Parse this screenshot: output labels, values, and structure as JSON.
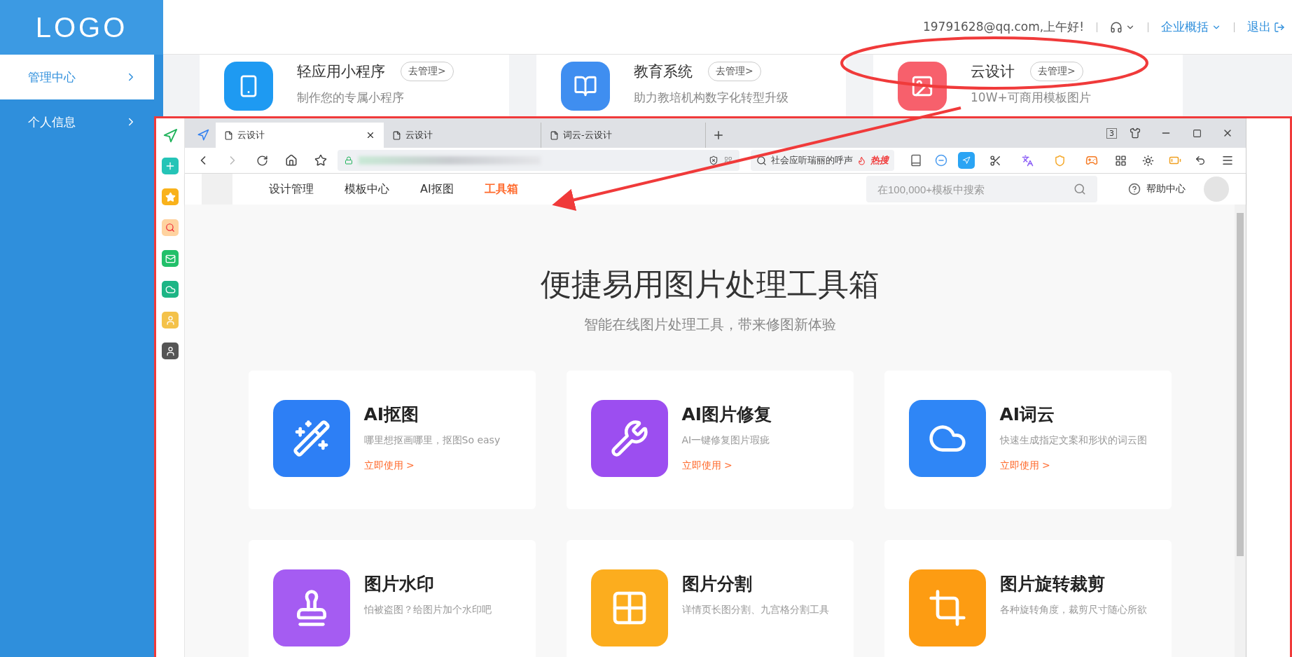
{
  "sidebar": {
    "logo": "LOGO",
    "items": [
      {
        "label": "管理中心",
        "selected": true
      },
      {
        "label": "个人信息",
        "selected": false
      }
    ]
  },
  "header": {
    "greeting": "19791628@qq.com,上午好!",
    "menu": "企业概括",
    "logout": "退出"
  },
  "products": [
    {
      "name": "轻应用小程序",
      "action": "去管理>",
      "desc": "制作您的专属小程序",
      "color": "#1e9af2"
    },
    {
      "name": "教育系统",
      "action": "去管理>",
      "desc": "助力教培机构数字化转型升级",
      "color": "#3f8ef0"
    },
    {
      "name": "云设计",
      "action": "去管理>",
      "desc": "10W+可商用模板图片",
      "color": "#f7606c"
    }
  ],
  "screenshot": {
    "browser": {
      "tabs": [
        {
          "title": "云设计",
          "selected": true
        },
        {
          "title": "云设计",
          "selected": false
        },
        {
          "title": "词云-云设计",
          "selected": false
        }
      ],
      "tab_count": "3",
      "hot_search": "社会应听瑞丽的呼声",
      "hot_label": "热搜"
    },
    "app": {
      "nav": [
        {
          "label": "设计管理",
          "selected": false
        },
        {
          "label": "模板中心",
          "selected": false
        },
        {
          "label": "AI抠图",
          "selected": false
        },
        {
          "label": "工具箱",
          "selected": true
        }
      ],
      "search": {
        "placeholder": "在100,000+模板中搜索"
      },
      "help": "帮助中心",
      "title": "便捷易用图片处理工具箱",
      "subtitle": "智能在线图片处理工具，带来修图新体验",
      "tools": [
        {
          "kind": "wand",
          "name": "AI抠图",
          "desc": "哪里想抠画哪里，抠图So easy",
          "link": "立即使用 >",
          "color": "#2d7ff5"
        },
        {
          "kind": "wrench",
          "name": "AI图片修复",
          "desc": "AI一键修复图片瑕疵",
          "link": "立即使用 >",
          "color": "#9c4ef0"
        },
        {
          "kind": "cloud",
          "name": "AI词云",
          "desc": "快速生成指定文案和形状的词云图",
          "link": "立即使用 >",
          "color": "#2f86f6"
        },
        {
          "kind": "stamp",
          "name": "图片水印",
          "desc": "怕被盗图？给图片加个水印吧",
          "color": "#a55cf2"
        },
        {
          "kind": "grid",
          "name": "图片分割",
          "desc": "详情页长图分割、九宫格分割工具",
          "color": "#fcad1e"
        },
        {
          "kind": "crop",
          "name": "图片旋转裁剪",
          "desc": "各种旋转角度，裁剪尺寸随心所欲",
          "color": "#fd9c12"
        }
      ]
    }
  }
}
